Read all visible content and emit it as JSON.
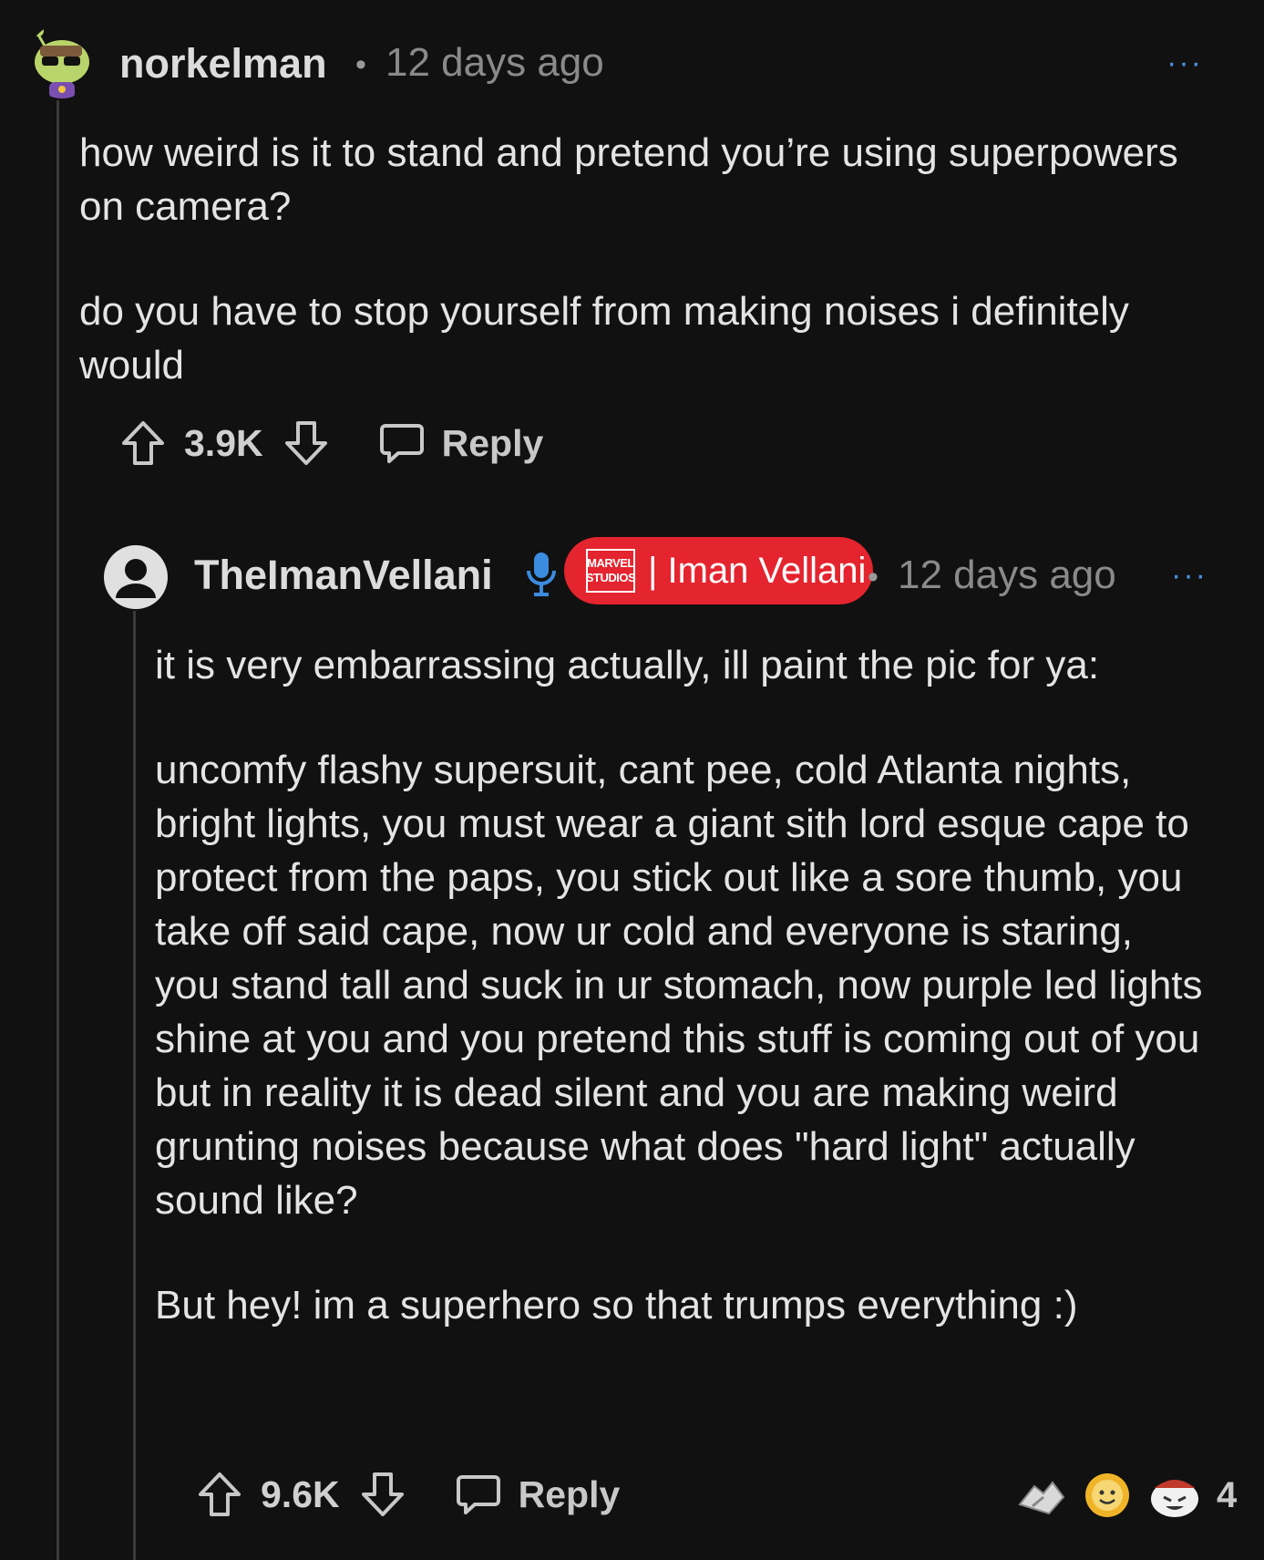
{
  "comments": [
    {
      "username": "norkelman",
      "separator": "•",
      "time": "12 days ago",
      "more": "···",
      "paragraphs": [
        "how weird is it to stand and pretend you’re using superpowers on camera?",
        "do you have to stop yourself from making noises i definitely would"
      ],
      "votes": "3.9K",
      "reply": "Reply"
    },
    {
      "username": "TheImanVellani",
      "flair_logo_top": "MARVEL",
      "flair_logo_bottom": "STUDIOS",
      "flair_text": "| Iman Vellani",
      "separator": "•",
      "time": "12 days ago",
      "more": "···",
      "paragraphs": [
        "it is very embarrassing actually, ill paint the pic for ya:",
        "uncomfy flashy supersuit, cant pee, cold Atlanta nights, bright lights, you must wear a giant sith lord esque cape to protect from the paps, you stick out like a sore thumb, you take off said cape, now ur cold and everyone is staring, you stand tall and suck in ur stomach, now purple led lights shine at you and you pretend this stuff is coming out of you but in reality it is dead silent and you are making weird grunting noises because what does \"hard light\" actually sound like?",
        "But hey! im a superhero so that trumps everything :)"
      ],
      "votes": "9.6K",
      "reply": "Reply",
      "awards": [
        "handshake-award-icon",
        "sun-face-award-icon",
        "snoo-laughing-award-icon"
      ],
      "award_count": "4"
    }
  ],
  "colors": {
    "background": "#111111",
    "text": "#e4e4e4",
    "muted": "#8a8a8a",
    "flair": "#e4242e",
    "accent": "#4a90d9"
  }
}
